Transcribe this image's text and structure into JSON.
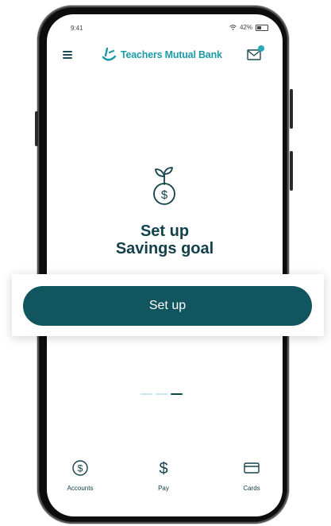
{
  "status_bar": {
    "time": "9:41",
    "battery": "42%",
    "wifi_icon": "wifi-icon",
    "battery_icon": "battery-icon"
  },
  "app_bar": {
    "menu_icon": "hamburger-menu-icon",
    "brand_name": "Teachers Mutual Bank",
    "mail_icon": "mail-icon",
    "mail_has_notification": true
  },
  "hero": {
    "icon": "money-plant-icon",
    "title_line1": "Set up",
    "title_line2": "Savings goal"
  },
  "primary_action": {
    "label": "Set up"
  },
  "carousel": {
    "page_count": 3,
    "active_index": 2
  },
  "tab_bar": {
    "items": [
      {
        "label": "Accounts",
        "icon": "dollar-circle-icon"
      },
      {
        "label": "Pay",
        "icon": "dollar-sign-icon"
      },
      {
        "label": "Cards",
        "icon": "card-icon"
      }
    ]
  },
  "colors": {
    "brand_teal": "#1b9aa6",
    "dark_teal": "#11565f",
    "text_dark": "#13414b",
    "dot_inactive": "#c5e6ec"
  }
}
